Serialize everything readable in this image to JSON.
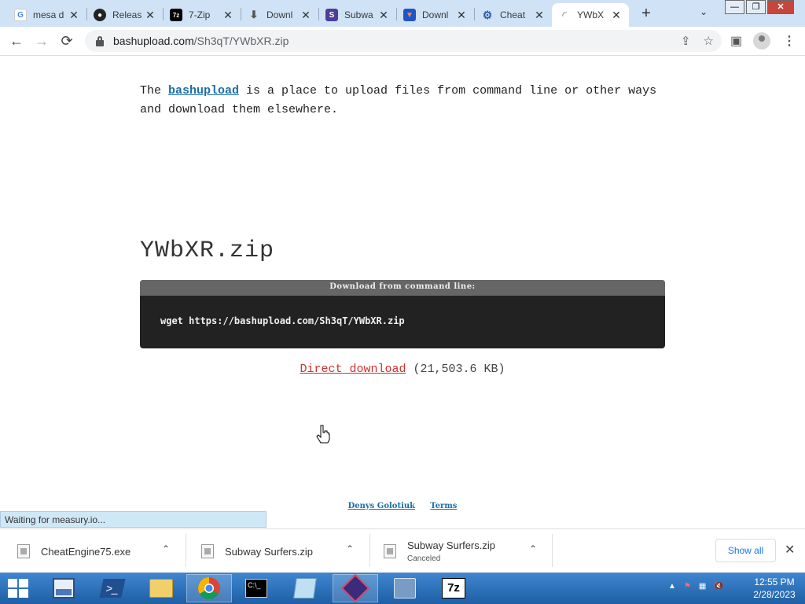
{
  "browser": {
    "tabs": [
      {
        "title": "mesa d",
        "icon": "google-icon",
        "color": "#4285f4"
      },
      {
        "title": "Releas",
        "icon": "github-icon",
        "color": "#222222"
      },
      {
        "title": "7-Zip",
        "icon": "7zip-icon",
        "color": "#000000"
      },
      {
        "title": "Downl",
        "icon": "download-icon",
        "color": "#555555"
      },
      {
        "title": "Subwa",
        "icon": "subway-icon",
        "color": "#4b3f9a"
      },
      {
        "title": "Downl",
        "icon": "shield-icon",
        "color": "#1e56c8"
      },
      {
        "title": "Cheat",
        "icon": "gear-icon",
        "color": "#2a5da8"
      },
      {
        "title": "YWbX",
        "icon": "loading-icon",
        "color": "#cccccc"
      }
    ],
    "active_tab": 7,
    "new_tab": "+",
    "address": {
      "host": "bashupload.com",
      "path": "/Sh3qT/YWbXR.zip"
    }
  },
  "page": {
    "intro_before": "The ",
    "intro_link": "bashupload",
    "intro_after": " is a place to upload files from command line or other ways and download them elsewhere.",
    "filename": "YWbXR.zip",
    "cmd_header": "Download from command line:",
    "cmd_text": "wget https://bashupload.com/Sh3qT/YWbXR.zip",
    "direct_link": "Direct download",
    "file_size": "(21,503.6 KB)",
    "footer_author": "Denys Golotiuk",
    "footer_terms": "Terms"
  },
  "status_text": "Waiting for measury.io...",
  "downloads": {
    "items": [
      {
        "name": "CheatEngine75.exe",
        "sub": ""
      },
      {
        "name": "Subway Surfers.zip",
        "sub": ""
      },
      {
        "name": "Subway Surfers.zip",
        "sub": "Canceled"
      }
    ],
    "show_all": "Show all"
  },
  "taskbar": {
    "apps": [
      "server-manager-icon",
      "powershell-icon",
      "file-explorer-icon",
      "chrome-icon",
      "cmd-icon",
      "notepad-icon",
      "app-icon",
      "network-icon",
      "7zip-icon"
    ],
    "active_app": 3,
    "time": "12:55 PM",
    "date": "2/28/2023"
  }
}
